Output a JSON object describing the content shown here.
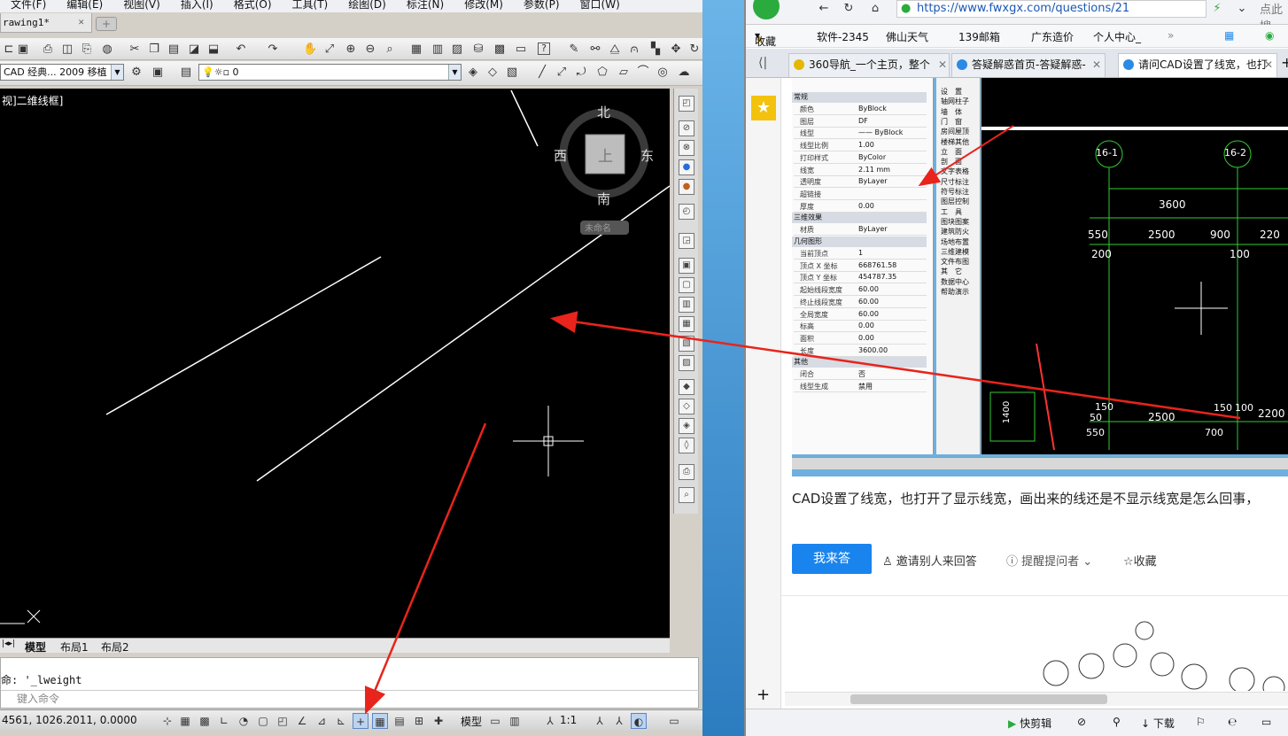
{
  "cad": {
    "menu": [
      "文件(F)",
      "编辑(E)",
      "视图(V)",
      "插入(I)",
      "格式(O)",
      "工具(T)",
      "绘图(D)",
      "标注(N)",
      "修改(M)",
      "参数(P)",
      "窗口(W)"
    ],
    "doc_tab": "rawing1*",
    "doc_close": "✕",
    "workspace": "CAD 经典... 2009 移植",
    "layer": "0",
    "viewport_label": "视]二维线框]",
    "compass": {
      "north": "北",
      "south": "南",
      "east": "东",
      "west": "西",
      "top": "上",
      "ucs": "未命名"
    },
    "layout_tabs": [
      "模型",
      "布局1",
      "布局2"
    ],
    "command_history": "命: '_lweight",
    "command_prompt": "键入命令",
    "coords": "4561, 1026.2011, 0.0000",
    "model_label": "模型",
    "scale": "1:1"
  },
  "browser": {
    "url": "https://www.fwxgx.com/questions/21",
    "search_hint": "点此搜",
    "bookmarks": [
      "收藏",
      "软件-2345",
      "佛山天气",
      "139邮箱",
      "广东造价",
      "个人中心_"
    ],
    "tabs": [
      {
        "label": "360导航_一个主页，整个",
        "active": false,
        "color": "#2bab3d"
      },
      {
        "label": "答疑解惑首页-答疑解惑-",
        "active": false,
        "color": "#2a8be4"
      },
      {
        "label": "请问CAD设置了线宽，也打",
        "active": true,
        "color": "#2a8be4"
      }
    ],
    "embed": {
      "props_head": [
        "常规",
        "三维效果",
        "几何图形",
        "其他"
      ],
      "props": [
        [
          "颜色",
          "ByBlock"
        ],
        [
          "图层",
          "DF"
        ],
        [
          "线型",
          "—— ByBlock"
        ],
        [
          "线型比例",
          "1.00"
        ],
        [
          "打印样式",
          "ByColor"
        ],
        [
          "线宽",
          "2.11 mm"
        ],
        [
          "透明度",
          "ByLayer"
        ],
        [
          "超链接",
          ""
        ],
        [
          "厚度",
          "0.00"
        ],
        [
          "材质",
          "ByLayer"
        ],
        [
          "当前顶点",
          "1"
        ],
        [
          "顶点 X 坐标",
          "668761.58"
        ],
        [
          "顶点 Y 坐标",
          "454787.35"
        ],
        [
          "起始线段宽度",
          "60.00"
        ],
        [
          "终止线段宽度",
          "60.00"
        ],
        [
          "全局宽度",
          "60.00"
        ],
        [
          "标高",
          "0.00"
        ],
        [
          "面积",
          "0.00"
        ],
        [
          "长度",
          "3600.00"
        ],
        [
          "闭合",
          "否"
        ],
        [
          "线型生成",
          "禁用"
        ]
      ],
      "menu_items": [
        "设　置",
        "轴网柱子",
        "墙　体",
        "门　窗",
        "房间屋顶",
        "楼梯其他",
        "立　面",
        "剖　面",
        "文字表格",
        "尺寸标注",
        "符号标注",
        "图层控制",
        "工　具",
        "图块图案",
        "建筑防火",
        "场地布置",
        "三维建模",
        "文件布图",
        "其　它",
        "数据中心",
        "帮助演示"
      ],
      "dims": [
        "3600",
        "550",
        "2500",
        "900",
        "220",
        "200",
        "100",
        "150",
        "50",
        "2500",
        "150",
        "100",
        "550",
        "700",
        "1400",
        "2200"
      ],
      "axes": [
        "16-1",
        "16-2"
      ]
    },
    "question": "CAD设置了线宽，也打开了显示线宽，画出来的线还是不显示线宽是怎么回事，",
    "answer_btn": "我来答",
    "invite": "邀请别人来回答",
    "remind": "提醒提问者",
    "favorite": "收藏",
    "status": [
      "快剪辑",
      "下载"
    ]
  }
}
